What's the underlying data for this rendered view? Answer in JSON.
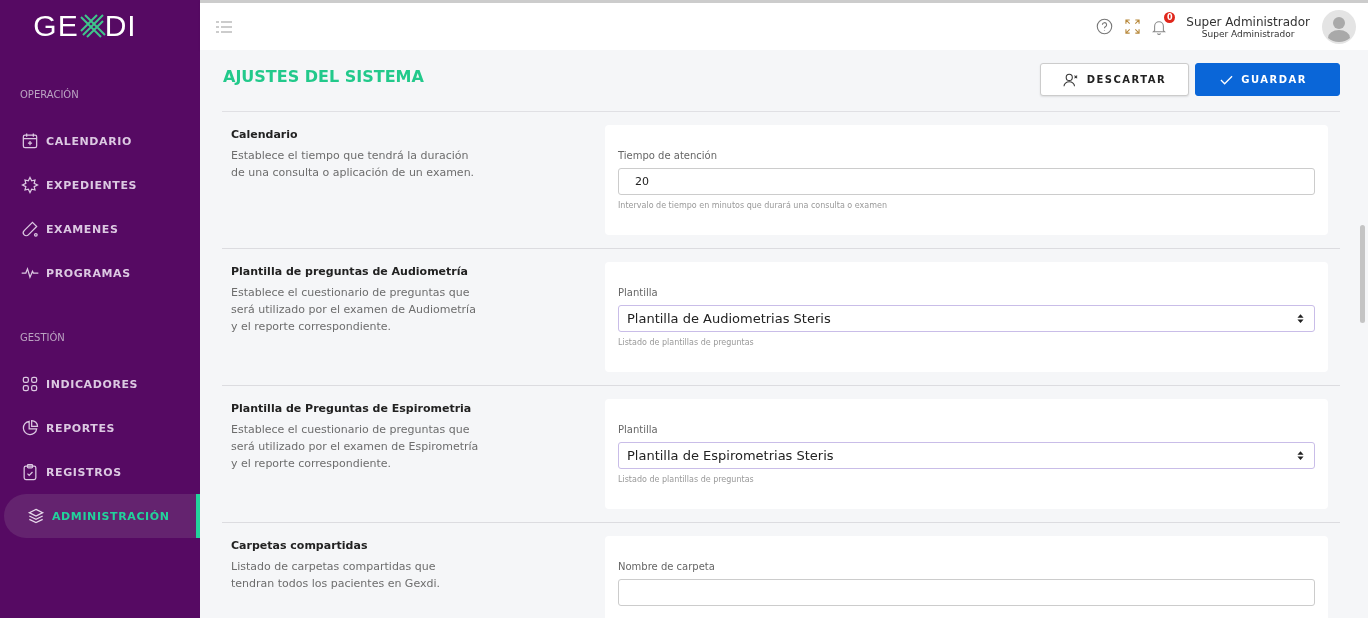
{
  "sidebar": {
    "logo": {
      "left": "GE",
      "right": "DI"
    },
    "groups": [
      {
        "label": "OPERACIÓN",
        "items": [
          {
            "label": "CALENDARIO",
            "selected": false
          },
          {
            "label": "EXPEDIENTES",
            "selected": false
          },
          {
            "label": "EXAMENES",
            "selected": false
          },
          {
            "label": "PROGRAMAS",
            "selected": false
          }
        ]
      },
      {
        "label": "GESTIÓN",
        "items": [
          {
            "label": "INDICADORES",
            "selected": false
          },
          {
            "label": "REPORTES",
            "selected": false
          },
          {
            "label": "REGISTROS",
            "selected": false
          },
          {
            "label": "ADMINISTRACIÓN",
            "selected": true
          }
        ]
      }
    ]
  },
  "topbar": {
    "notification_count": "0",
    "user": {
      "name": "Super Administrador",
      "role": "Super Administrador"
    }
  },
  "page": {
    "title": "AJUSTES DEL SISTEMA",
    "buttons": [
      {
        "label": "DESCARTAR",
        "kind": "secondary"
      },
      {
        "label": "GUARDAR",
        "kind": "primary"
      }
    ]
  },
  "sections": [
    {
      "title": "Calendario",
      "description": "Establece el tiempo que tendrá la duración de una consulta o aplicación de un examen.",
      "field": {
        "kind": "input",
        "label": "Tiempo de atención",
        "value": "20",
        "help": "Intervalo de tiempo en minutos que durará una consulta o examen"
      }
    },
    {
      "title": "Plantilla de preguntas de Audiometría",
      "description": "Establece el cuestionario de preguntas que será utilizado por el examen de Audiometría y el reporte correspondiente.",
      "field": {
        "kind": "select",
        "label": "Plantilla",
        "value": "Plantilla de Audiometrias Steris",
        "help": "Listado de plantillas de preguntas"
      }
    },
    {
      "title": "Plantilla de Preguntas de Espirometria",
      "description": "Establece el cuestionario de preguntas que será utilizado por el examen de Espirometría y el reporte correspondiente.",
      "field": {
        "kind": "select",
        "label": "Plantilla",
        "value": "Plantilla de Espirometrias Steris",
        "help": "Listado de plantillas de preguntas"
      }
    },
    {
      "title": "Carpetas compartidas",
      "description": "Listado de carpetas compartidas que tendran todos los pacientes en Gexdi.",
      "field": {
        "kind": "input",
        "label": "Nombre de carpeta"
      }
    }
  ]
}
